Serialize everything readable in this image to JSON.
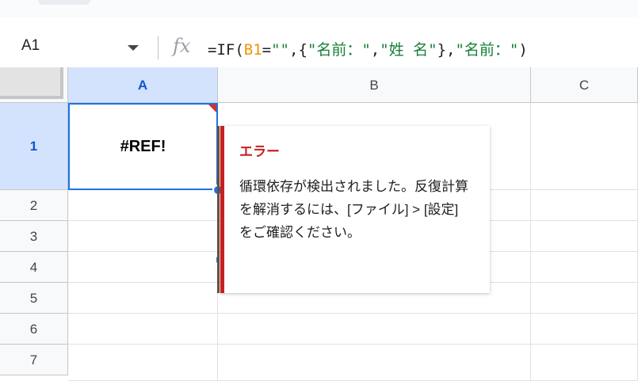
{
  "formula_bar": {
    "name_box": "A1",
    "fx_label": "fx",
    "formula_parts": [
      {
        "text": "=IF(",
        "kind": "plain"
      },
      {
        "text": "B1",
        "kind": "ref"
      },
      {
        "text": "=",
        "kind": "plain"
      },
      {
        "text": "\"\"",
        "kind": "str"
      },
      {
        "text": ",{",
        "kind": "plain"
      },
      {
        "text": "\"名前：\"",
        "kind": "str"
      },
      {
        "text": ",",
        "kind": "plain"
      },
      {
        "text": "\"姓 名\"",
        "kind": "str"
      },
      {
        "text": "},",
        "kind": "plain"
      },
      {
        "text": "\"名前：\"",
        "kind": "str"
      },
      {
        "text": ")",
        "kind": "plain"
      }
    ]
  },
  "grid": {
    "columns": [
      "A",
      "B",
      "C"
    ],
    "rows": [
      "1",
      "2",
      "3",
      "4",
      "5",
      "6",
      "7"
    ],
    "active_cell": "A1",
    "a1_value": "#REF!"
  },
  "error_tooltip": {
    "title": "エラー",
    "message": "循環依存が検出されました。反復計算を解消するには、[ファイル] > [設定] をご確認ください。"
  },
  "colors": {
    "selection": "#1a73e8",
    "header_active_bg": "#d3e3fd",
    "error_red": "#c5221f",
    "ref_orange": "#f09300",
    "string_green": "#188038"
  }
}
